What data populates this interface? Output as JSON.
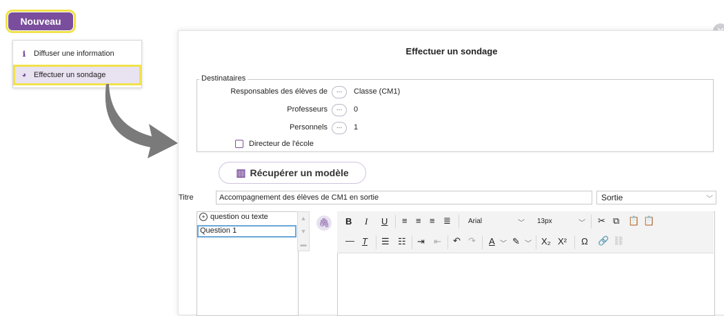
{
  "toolbar": {
    "nouveau_label": "Nouveau"
  },
  "menu": {
    "items": [
      {
        "icon": "info-icon",
        "label": "Diffuser une information"
      },
      {
        "icon": "pie-chart-icon",
        "label": "Effectuer un sondage"
      }
    ]
  },
  "dialog": {
    "title": "Effectuer un sondage",
    "destinataires": {
      "legend": "Destinataires",
      "rows": [
        {
          "label": "Responsables des élèves de",
          "button": "...",
          "value": "Classe (CM1)"
        },
        {
          "label": "Professeurs",
          "button": "...",
          "value": "0"
        },
        {
          "label": "Personnels",
          "button": "...",
          "value": "1"
        }
      ],
      "checkbox_label": "Directeur de l'école"
    },
    "modele_button": "Récupérer un modèle",
    "titre_label": "Titre",
    "titre_value": "Accompagnement des élèves de CM1 en sortie",
    "category_select": "Sortie",
    "questions": {
      "add_label": "question ou texte",
      "items": [
        "Question 1"
      ]
    },
    "editor": {
      "font_family": "Arial",
      "font_size": "13px",
      "buttons_row1": [
        "B",
        "I",
        "U"
      ],
      "buttons_row2_special": [
        "Ω"
      ]
    }
  }
}
